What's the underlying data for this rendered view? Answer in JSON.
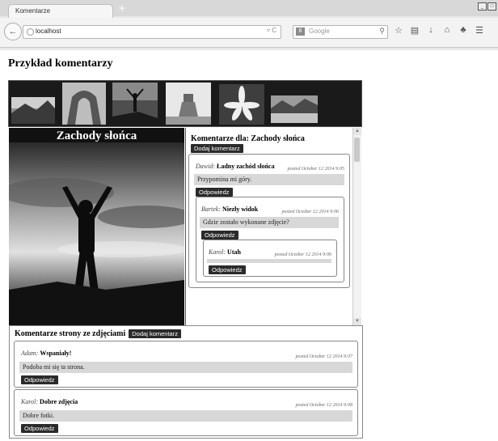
{
  "browser": {
    "tab_title": "Komentarze",
    "new_tab": "+",
    "url": "localhost",
    "search_engine_badge": "8",
    "search_placeholder": "Google",
    "window_min": "_",
    "window_max": "□"
  },
  "page": {
    "title": "Przykład komentarzy"
  },
  "viewer": {
    "photo_title": "Zachody słońca",
    "comments_header": "Komentarze dla: Zachody słońca",
    "add_comment": "Dodaj komentarz",
    "comments": [
      {
        "author": "Dawid",
        "title": "Ładny zachód słońca",
        "posted": "posted October 12 2014 9:05",
        "body": "Przypomina mi góry.",
        "reply": "Odpowiedz"
      },
      {
        "author": "Bartek",
        "title": "Niezły widok",
        "posted": "posted October 12 2014 9:06",
        "body": "Gdzie zostało wykonane zdjęcie?",
        "reply": "Odpowiedz"
      },
      {
        "author": "Karol",
        "title": "Utah",
        "posted": "posted October 12 2014 9:06",
        "body": "",
        "reply": "Odpowiedz"
      }
    ]
  },
  "page_comments": {
    "header": "Komentarze strony ze zdjęciami",
    "add_comment": "Dodaj komentarz",
    "comments": [
      {
        "author": "Adam",
        "title": "Wspaniały!",
        "posted": "posted October 12 2014 9:07",
        "body": "Podoba mi się ta strona.",
        "reply": "Odpowiedz"
      },
      {
        "author": "Karol",
        "title": "Dobre zdjęcia",
        "posted": "posted October 12 2014 9:08",
        "body": "Dobre fotki.",
        "reply": "Odpowiedz"
      }
    ]
  },
  "icons": [
    "back-arrow-icon",
    "globe-icon",
    "reload-icon",
    "search-icon",
    "star-icon",
    "clipboard-icon",
    "download-icon",
    "home-icon",
    "puzzle-icon",
    "menu-icon"
  ]
}
